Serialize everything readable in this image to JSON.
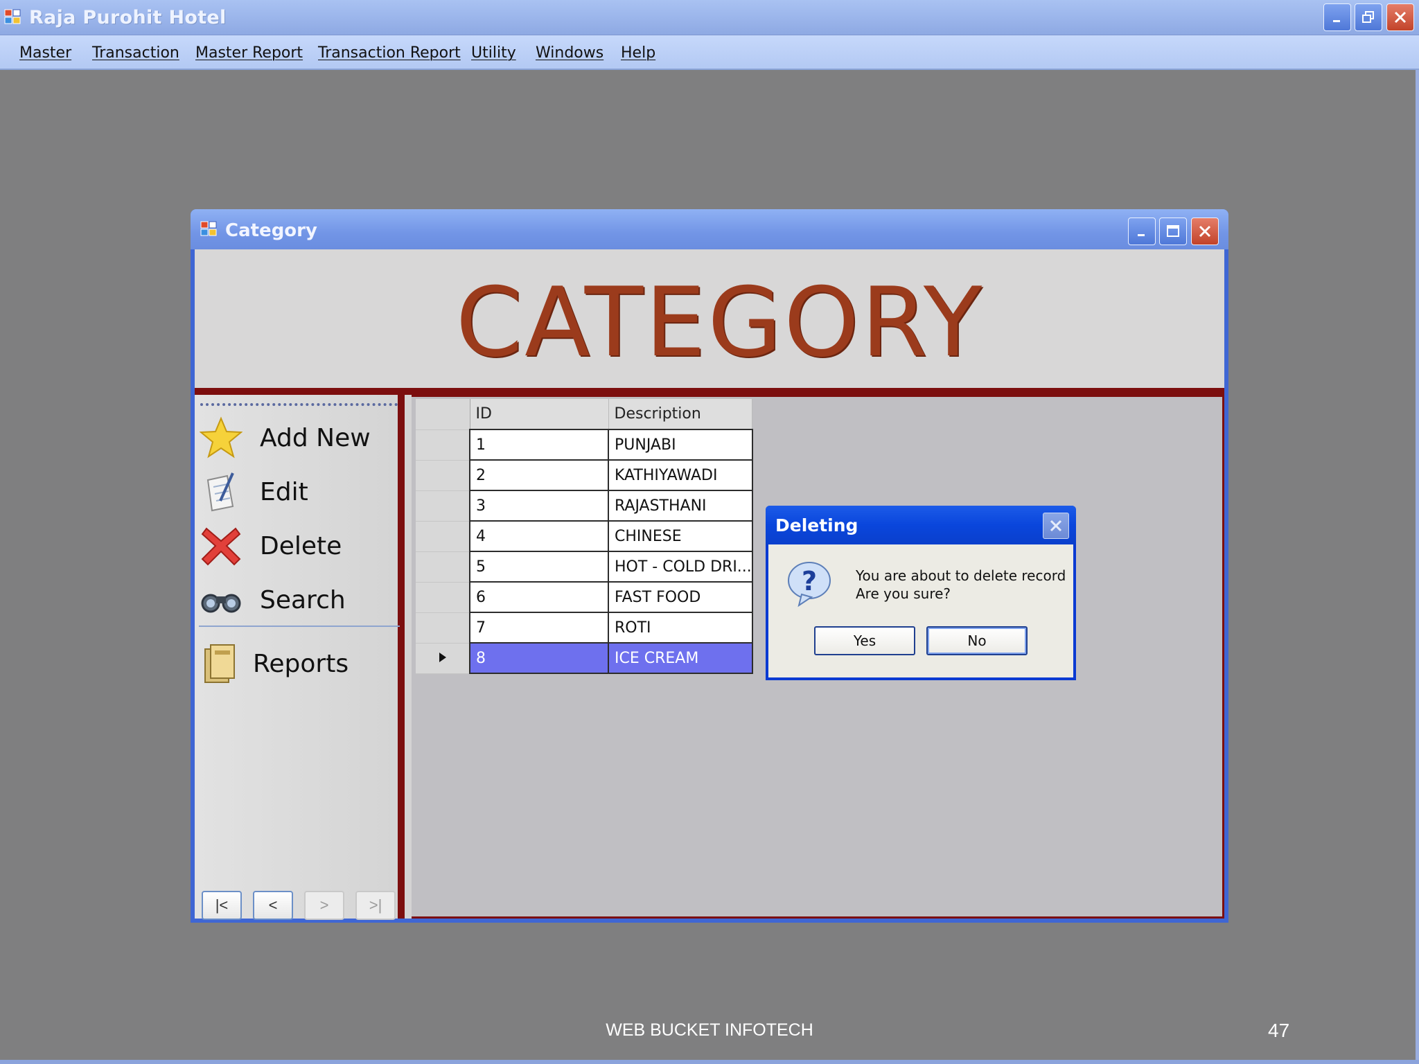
{
  "app": {
    "title": "Raja Purohit Hotel"
  },
  "menu": {
    "items": [
      "Master",
      "Transaction",
      "Master Report",
      "Transaction Report",
      "Utility",
      "Windows",
      "Help"
    ]
  },
  "category_window": {
    "title": "Category",
    "banner": "CATEGORY",
    "nav": {
      "add_new": "Add New",
      "edit": "Edit",
      "delete": "Delete",
      "search": "Search",
      "reports": "Reports"
    },
    "grid": {
      "columns": [
        "ID",
        "Description"
      ],
      "rows": [
        {
          "id": "1",
          "description": "PUNJABI"
        },
        {
          "id": "2",
          "description": "KATHIYAWADI"
        },
        {
          "id": "3",
          "description": "RAJASTHANI"
        },
        {
          "id": "4",
          "description": "CHINESE"
        },
        {
          "id": "5",
          "description": "HOT - COLD DRI..."
        },
        {
          "id": "6",
          "description": "FAST FOOD"
        },
        {
          "id": "7",
          "description": "ROTI"
        },
        {
          "id": "8",
          "description": "ICE CREAM"
        }
      ],
      "selected_row": 8
    }
  },
  "dialog": {
    "title": "Deleting",
    "message_line1": "You are about to delete record",
    "message_line2": "Are you sure?",
    "yes": "Yes",
    "no": "No"
  },
  "footer": {
    "text": "WEB BUCKET INFOTECH",
    "page": "47"
  },
  "colors": {
    "accent_red": "#7c0e0e",
    "banner_text": "#9b3b1c",
    "selection": "#6e70ee",
    "dialog_blue": "#0a3ad2"
  }
}
